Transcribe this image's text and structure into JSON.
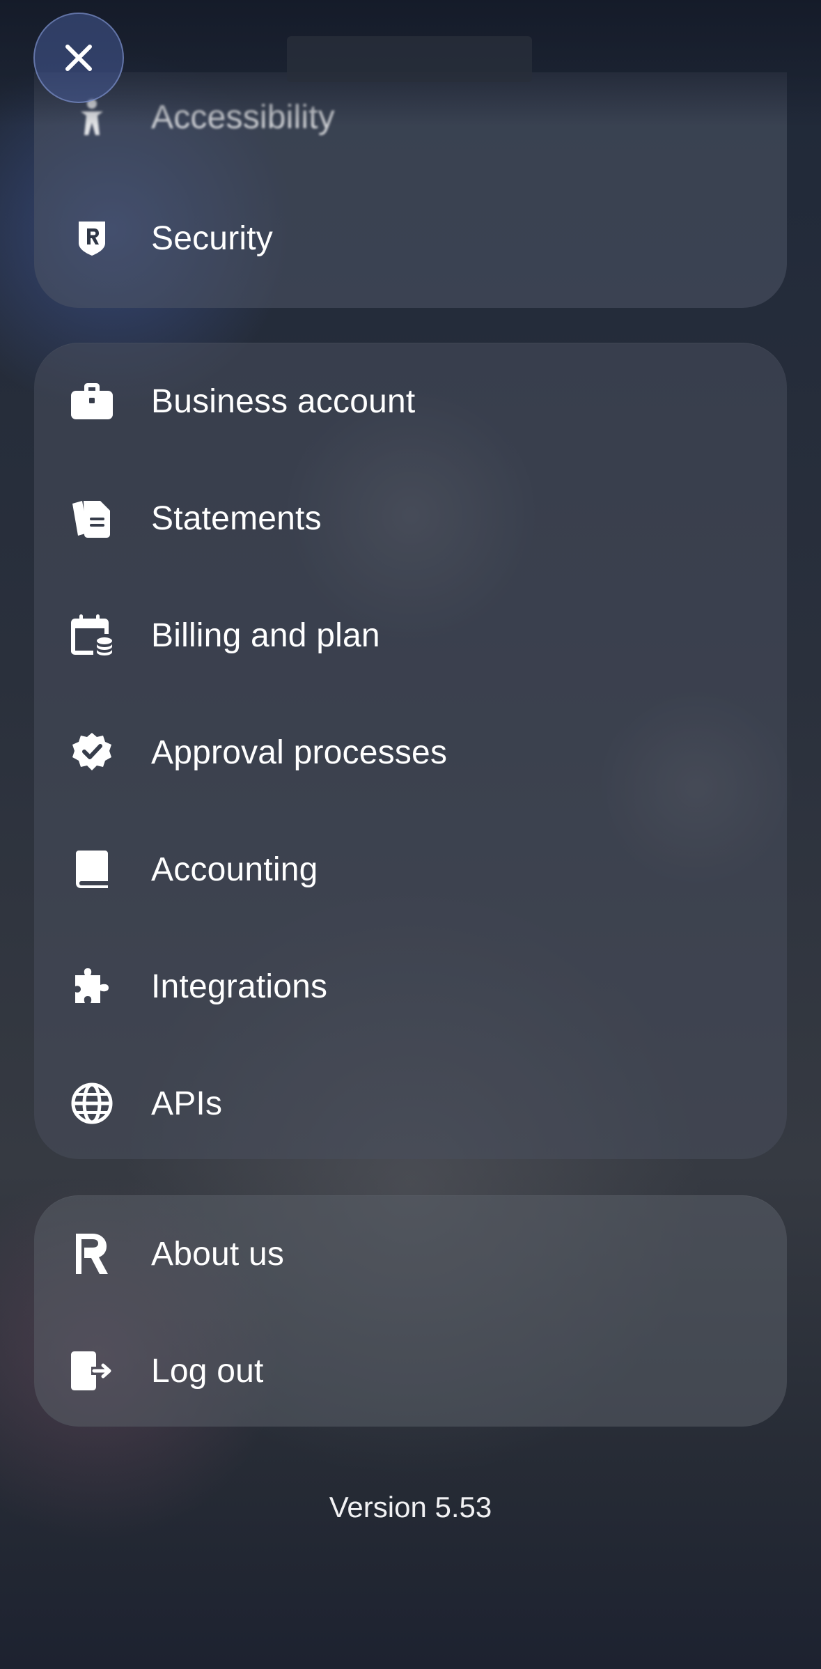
{
  "header": {
    "close_icon": "close-icon"
  },
  "groups": [
    {
      "items": [
        {
          "label": "Accessibility",
          "icon": "accessibility-icon"
        },
        {
          "label": "Security",
          "icon": "shield-icon"
        }
      ]
    },
    {
      "items": [
        {
          "label": "Business account",
          "icon": "briefcase-icon"
        },
        {
          "label": "Statements",
          "icon": "documents-icon"
        },
        {
          "label": "Billing and plan",
          "icon": "calendar-coins-icon"
        },
        {
          "label": "Approval processes",
          "icon": "verified-badge-icon"
        },
        {
          "label": "Accounting",
          "icon": "book-icon"
        },
        {
          "label": "Integrations",
          "icon": "puzzle-icon"
        },
        {
          "label": "APIs",
          "icon": "globe-icon"
        }
      ]
    },
    {
      "items": [
        {
          "label": "About us",
          "icon": "revolut-logo-icon"
        },
        {
          "label": "Log out",
          "icon": "log-out-icon"
        }
      ]
    }
  ],
  "footer": {
    "version": "Version 5.53"
  }
}
